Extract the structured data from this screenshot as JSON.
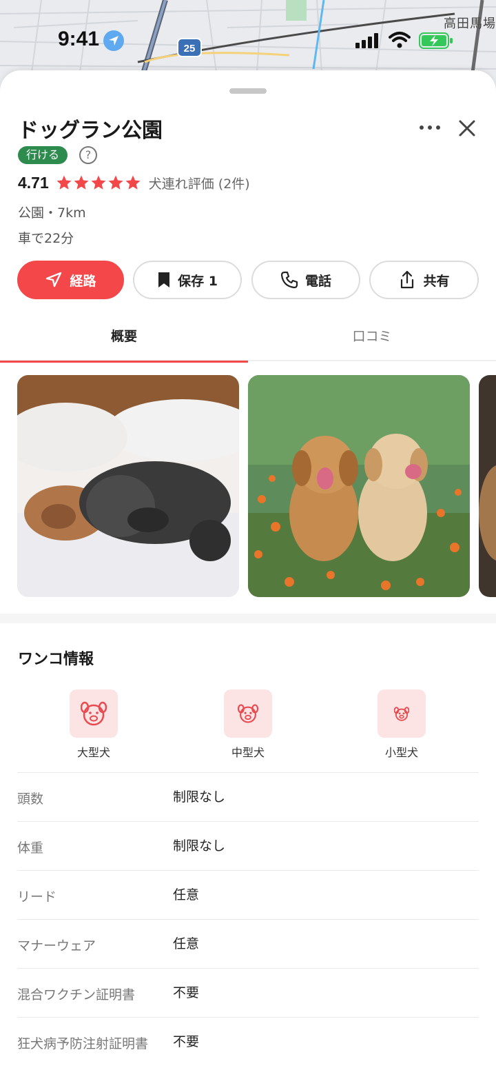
{
  "status_bar": {
    "time": "9:41",
    "location_icon": "location-arrow-icon",
    "battery": "charging"
  },
  "map": {
    "route_badge": "25",
    "place_label": "高田馬場"
  },
  "place": {
    "title": "ドッグラン公園",
    "open_badge": "行ける",
    "help_icon": "?",
    "rating": "4.71",
    "stars": 5,
    "rating_label": "犬連れ評価 (2件)",
    "category_distance": "公園・7km",
    "drive_time": "車で22分"
  },
  "actions": {
    "route_label": "経路",
    "save_label": "保存 1",
    "call_label": "電話",
    "share_label": "共有"
  },
  "tabs": {
    "overview": "概要",
    "reviews": "口コミ"
  },
  "dog_info": {
    "title": "ワンコ情報",
    "sizes": [
      "大型犬",
      "中型犬",
      "小型犬"
    ],
    "rows": [
      {
        "key": "頭数",
        "value": "制限なし"
      },
      {
        "key": "体重",
        "value": "制限なし"
      },
      {
        "key": "リード",
        "value": "任意"
      },
      {
        "key": "マナーウェア",
        "value": "任意"
      },
      {
        "key": "混合ワクチン証明書",
        "value": "不要"
      },
      {
        "key": "狂犬病予防注射証明書",
        "value": "不要"
      }
    ]
  },
  "colors": {
    "accent": "#f4474a",
    "badge_green": "#2e8b4e",
    "star": "#f4474a",
    "dog_tile": "#fde4e4"
  }
}
